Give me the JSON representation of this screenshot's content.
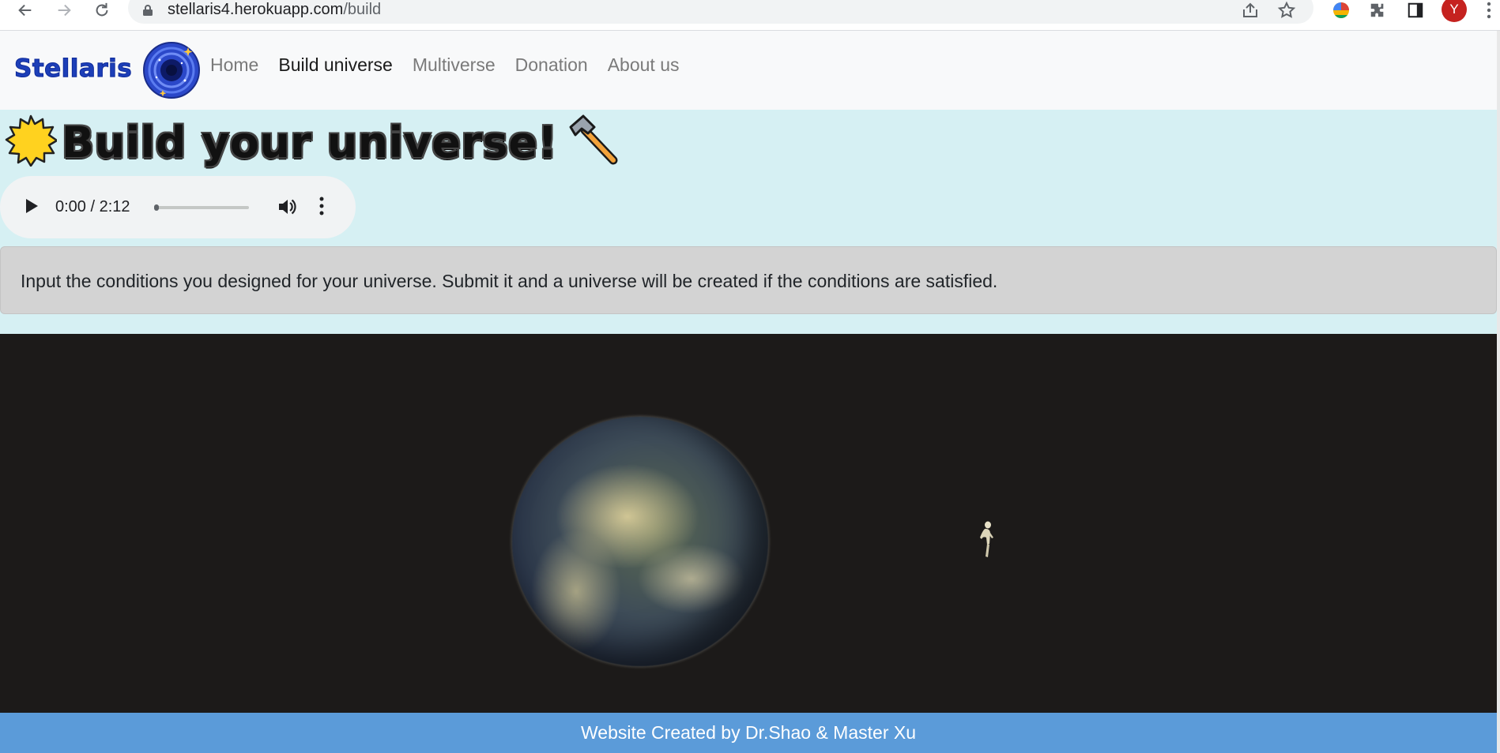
{
  "browser": {
    "url_host": "stellaris4.herokuapp.com",
    "url_path": "/build",
    "profile_initial": "Y"
  },
  "navbar": {
    "brand": "Stellaris",
    "links": [
      {
        "label": "Home",
        "active": false
      },
      {
        "label": "Build universe",
        "active": true
      },
      {
        "label": "Multiverse",
        "active": false
      },
      {
        "label": "Donation",
        "active": false
      },
      {
        "label": "About us",
        "active": false
      }
    ]
  },
  "page": {
    "title": "Build your universe!",
    "title_icons": [
      "sun-icon",
      "hammer-icon"
    ]
  },
  "audio": {
    "time": "0:00 / 2:12",
    "progress": 0
  },
  "info": {
    "text": "Input the conditions you designed for your universe. Submit it and a universe will be created if the conditions are satisfied."
  },
  "footer": {
    "text": "Website Created by Dr.Shao & Master Xu"
  },
  "colors": {
    "page_bg": "#d6f0f3",
    "navbar_bg": "#f8f9fa",
    "brand": "#1d3fb8",
    "info_bg": "#d3d3d3",
    "video_bg": "#1c1a19",
    "footer_bg": "#5b9bd9"
  }
}
